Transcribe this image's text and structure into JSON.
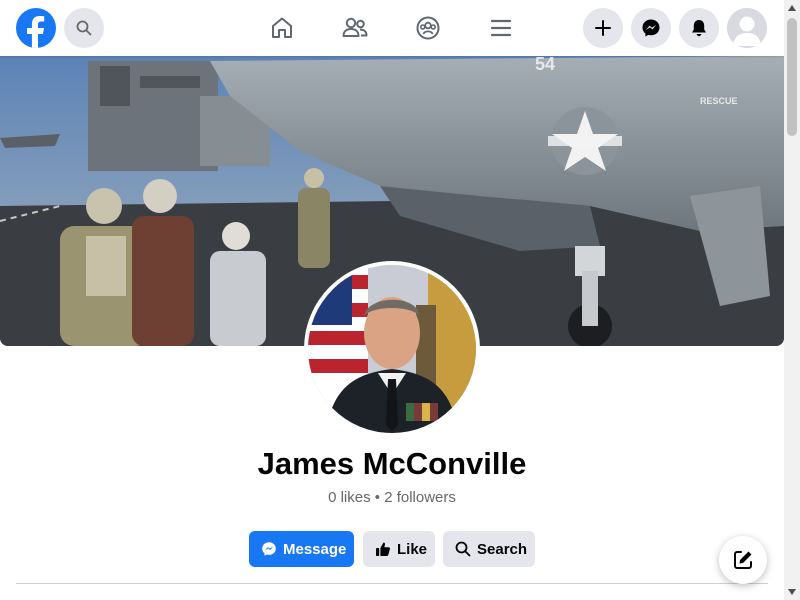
{
  "header": {
    "logo_icon": "facebook-logo",
    "search_icon": "search-icon",
    "nav_icons": [
      "home-icon",
      "friends-icon",
      "groups-icon",
      "menu-icon"
    ],
    "action_icons": [
      "plus-icon",
      "messenger-icon",
      "bell-icon",
      "profile-avatar-icon"
    ]
  },
  "cover": {
    "aircraft_marking": "54",
    "rescue_text": "RESCUE"
  },
  "profile": {
    "name": "James McConville",
    "stats": "0 likes • 2 followers"
  },
  "actions": {
    "message_label": "Message",
    "like_label": "Like",
    "search_label": "Search"
  },
  "colors": {
    "brand": "#1877f2",
    "secondary_button": "#e4e6eb",
    "muted_text": "#65676b"
  }
}
